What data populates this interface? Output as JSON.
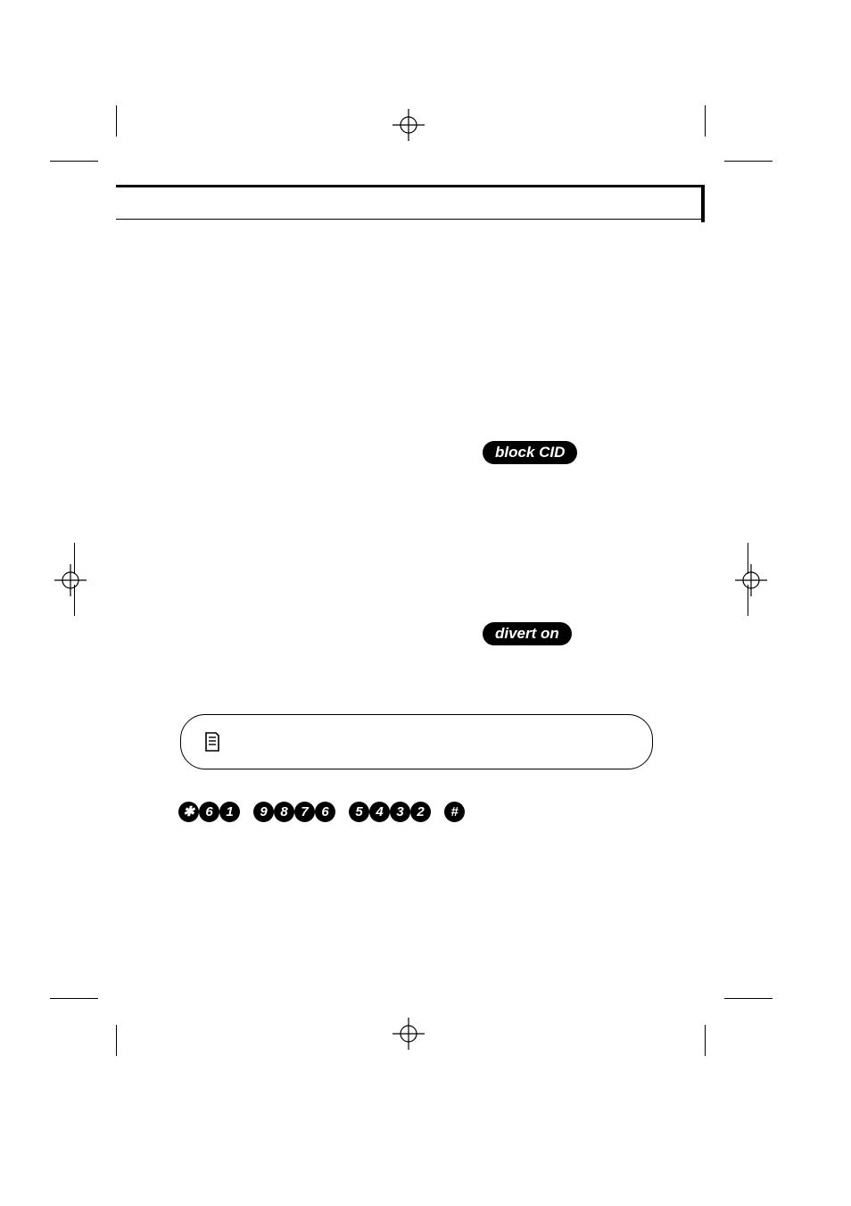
{
  "buttons": {
    "block_cid": "block CID",
    "divert_on": "divert on"
  },
  "dial_sequence": {
    "group1": [
      "✱",
      "6",
      "1"
    ],
    "group2": [
      "9",
      "8",
      "7",
      "6"
    ],
    "group3": [
      "5",
      "4",
      "3",
      "2"
    ],
    "group4": [
      "#"
    ]
  }
}
